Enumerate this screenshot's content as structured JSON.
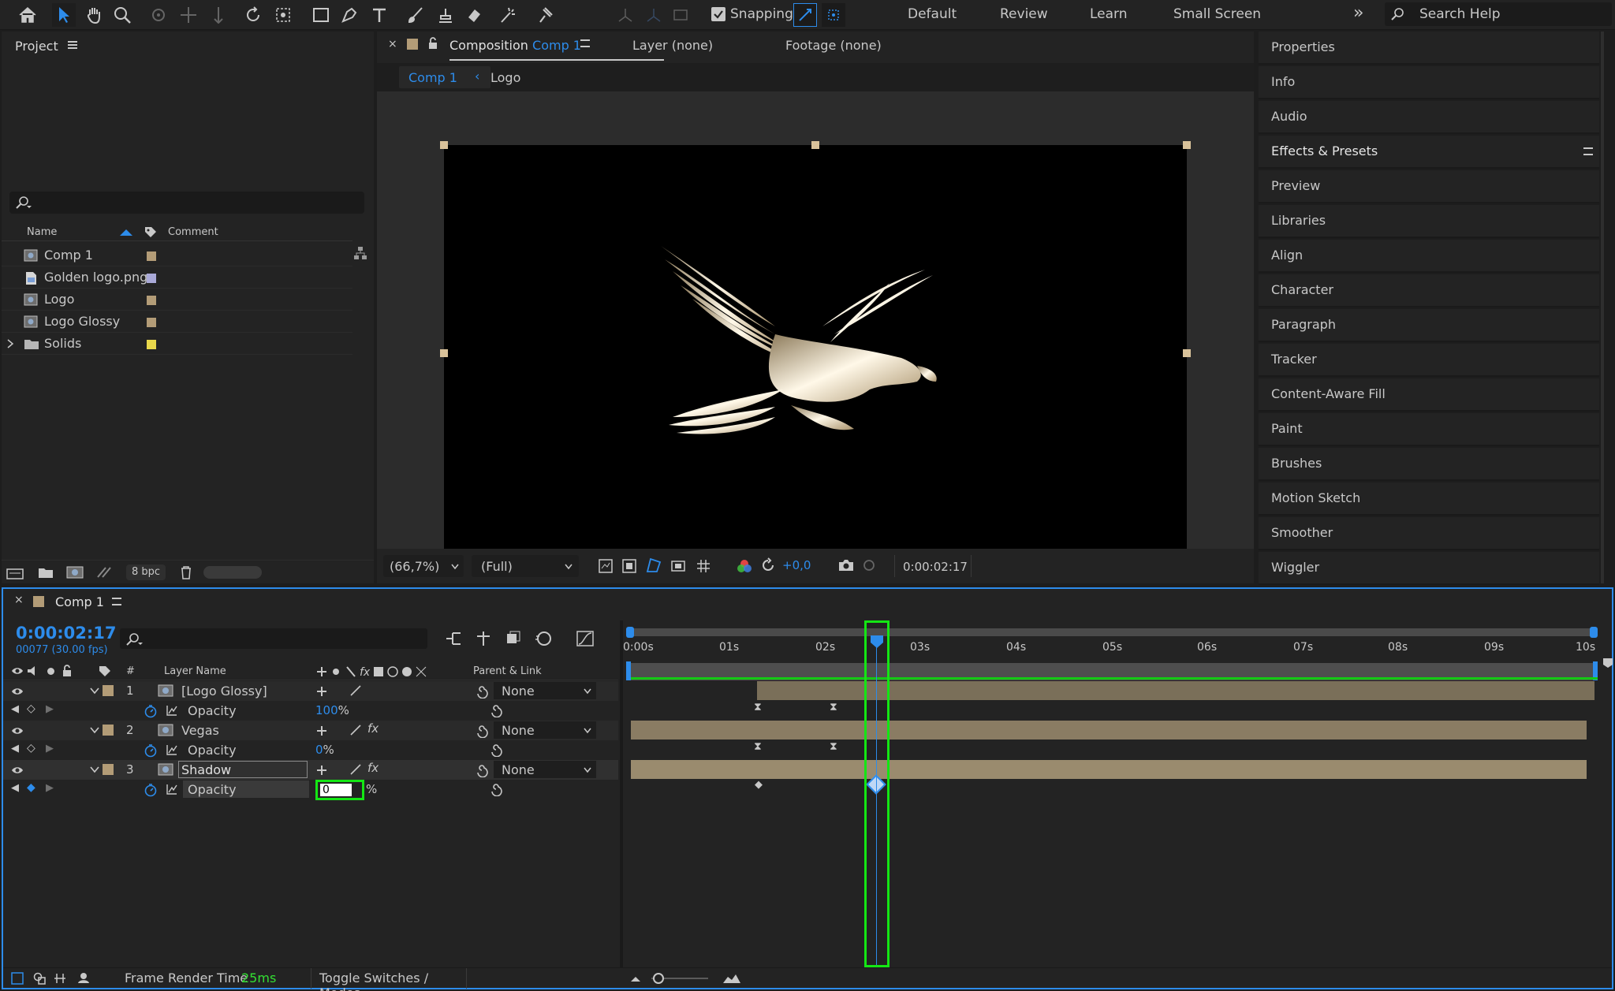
{
  "toolbar": {
    "snapping_label": "Snapping",
    "workspaces": [
      "Default",
      "Review",
      "Learn",
      "Small Screen"
    ],
    "search_placeholder": "Search Help"
  },
  "project": {
    "title": "Project",
    "search_placeholder": "",
    "columns": {
      "name": "Name",
      "comment": "Comment"
    },
    "items": [
      {
        "name": "Comp 1",
        "type": "composition",
        "color": "#b39c77"
      },
      {
        "name": "Golden logo.png",
        "type": "image",
        "color": "#a9a9d8"
      },
      {
        "name": "Logo",
        "type": "composition",
        "color": "#b39c77"
      },
      {
        "name": "Logo Glossy",
        "type": "composition",
        "color": "#b39c77"
      },
      {
        "name": "Solids",
        "type": "folder",
        "color": "#e9d84b"
      }
    ],
    "bpc": "8 bpc"
  },
  "composition": {
    "tab_prefix": "Composition",
    "tab_name": "Comp 1",
    "layer_tab": "Layer (none)",
    "footage_tab": "Footage (none)",
    "breadcrumb": [
      "Comp 1",
      "Logo"
    ],
    "zoom": "(66,7%)",
    "resolution": "(Full)",
    "exposure": "+0,0",
    "timecode": "0:00:02:17"
  },
  "right_panels": [
    "Properties",
    "Info",
    "Audio",
    "Effects & Presets",
    "Preview",
    "Libraries",
    "Align",
    "Character",
    "Paragraph",
    "Tracker",
    "Content-Aware Fill",
    "Paint",
    "Brushes",
    "Motion Sketch",
    "Smoother",
    "Wiggler"
  ],
  "timeline": {
    "tab_name": "Comp 1",
    "current_time": "0:00:02:17",
    "frame_info": "00077 (30.00 fps)",
    "columns": {
      "hash": "#",
      "layer_name": "Layer Name",
      "parent": "Parent & Link"
    },
    "layers": [
      {
        "index": "1",
        "name": "[Logo Glossy]",
        "parent": "None",
        "prop": "Opacity",
        "value": "100",
        "unit": "%"
      },
      {
        "index": "2",
        "name": "Vegas",
        "parent": "None",
        "prop": "Opacity",
        "value": "0",
        "unit": "%"
      },
      {
        "index": "3",
        "name": "Shadow",
        "parent": "None",
        "prop": "Opacity",
        "value": "0",
        "unit": "%"
      }
    ],
    "ruler": [
      "0:00s",
      "01s",
      "02s",
      "03s",
      "04s",
      "05s",
      "06s",
      "07s",
      "08s",
      "09s",
      "10s"
    ],
    "footer": {
      "render_label": "Frame Render Time",
      "render_value": "25ms",
      "toggle_label": "Toggle Switches / Modes"
    }
  },
  "colors": {
    "accent": "#2d8ceb",
    "highlight": "#14e614",
    "label_tan": "#b39c77"
  }
}
